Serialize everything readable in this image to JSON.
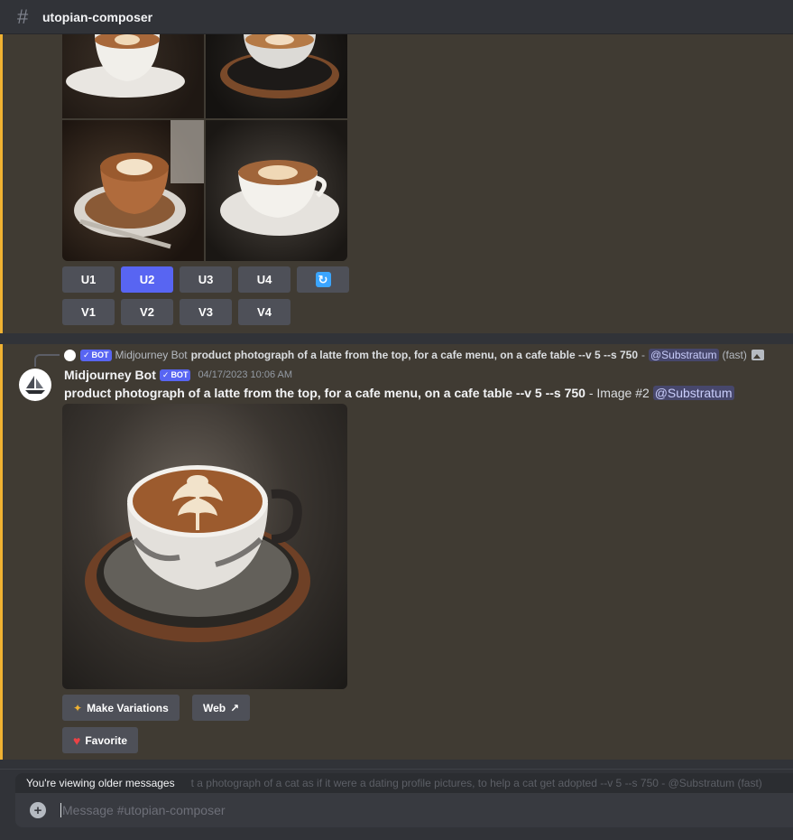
{
  "channel": {
    "name": "utopian-composer"
  },
  "grid_message": {
    "upscale_buttons": [
      "U1",
      "U2",
      "U3",
      "U4"
    ],
    "variation_buttons": [
      "V1",
      "V2",
      "V3",
      "V4"
    ],
    "active_button": "U2",
    "refresh_icon": "refresh-icon"
  },
  "message": {
    "reply": {
      "bot_tag": "BOT",
      "name": "Midjourney Bot",
      "prompt": "product photograph of a latte from the top, for a cafe menu, on a cafe table --v 5 --s 750",
      "separator": "-",
      "mention": "@Substratum",
      "speed": "(fast)"
    },
    "author": "Midjourney Bot",
    "bot_tag": "BOT",
    "timestamp": "04/17/2023 10:06 AM",
    "prompt": "product photograph of a latte from the top, for a cafe menu, on a cafe table --v 5 --s 750",
    "image_label": "- Image #2",
    "mention": "@Substratum",
    "buttons": {
      "make_variations": "Make Variations",
      "web": "Web",
      "favorite": "Favorite"
    }
  },
  "older_notice": "You're viewing older messages",
  "older_ghost": "t a photograph of a cat as if it were a dating profile pictures, to help a cat get adopted --v 5 --s 750 - @Substratum (fast)",
  "composer": {
    "placeholder": "Message #utopian-composer"
  },
  "colors": {
    "accent": "#5865f2",
    "highlight": "#f0b232",
    "bg": "#313338"
  }
}
